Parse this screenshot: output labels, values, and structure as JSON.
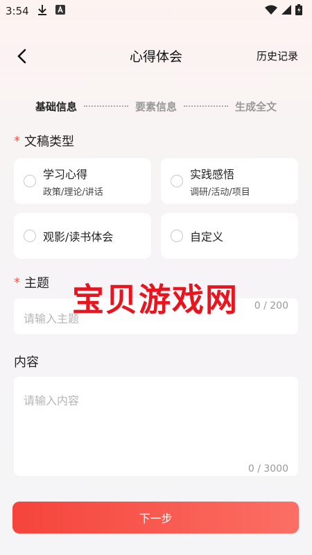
{
  "status_bar": {
    "time": "3:54",
    "icons": [
      "download-icon",
      "a-notification-icon",
      "wifi-icon",
      "signal-icon",
      "battery-icon"
    ]
  },
  "nav": {
    "title": "心得体会",
    "history_label": "历史记录"
  },
  "steps": [
    "基础信息",
    "要素信息",
    "生成全文"
  ],
  "doc_type": {
    "label": "文稿类型",
    "required_mark": "*",
    "options": [
      {
        "title": "学习心得",
        "subtitle": "政策/理论/讲话"
      },
      {
        "title": "实践感悟",
        "subtitle": "调研/活动/项目"
      },
      {
        "title": "观影/读书体会",
        "subtitle": ""
      },
      {
        "title": "自定义",
        "subtitle": ""
      }
    ]
  },
  "topic": {
    "label": "主题",
    "required_mark": "*",
    "placeholder": "请输入主题",
    "counter": "0 / 200"
  },
  "content": {
    "label": "内容",
    "placeholder": "请输入内容",
    "counter": "0 / 3000"
  },
  "watermark": "宝贝游戏网",
  "next_button": "下一步",
  "colors": {
    "accent": "#f5443b",
    "required": "#f05a4f",
    "watermark": "#e8141e"
  }
}
